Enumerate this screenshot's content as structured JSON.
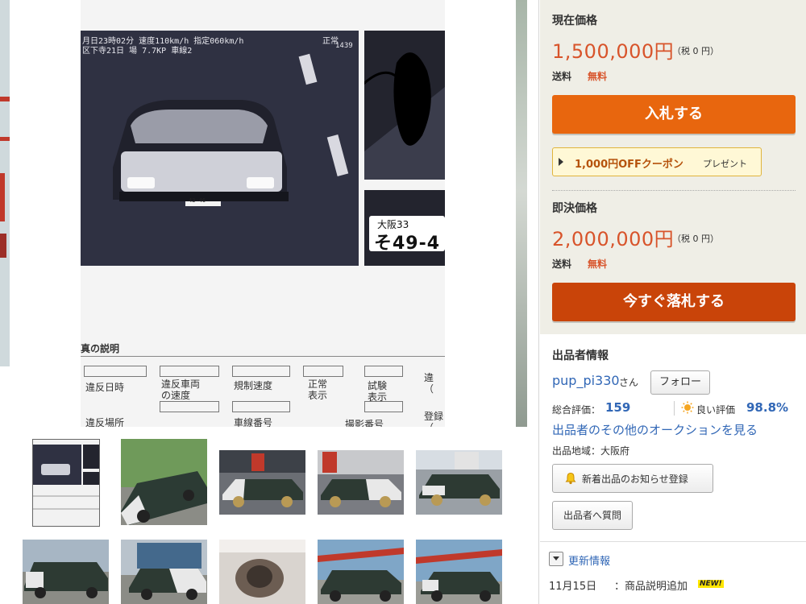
{
  "colors": {
    "accent_orange": "#e8660e",
    "buynow_orange": "#c94409",
    "price_text": "#d8542b",
    "link_blue": "#3167b6",
    "panel_bg": "#efeee6",
    "coupon_bg": "#fff8d6"
  },
  "photo": {
    "overlay_line1": "月日23時02分  速度110km/h  指定060km/h",
    "overlay_line2": "区下寺21日  場  7.7KP  車線2",
    "overlay_status": "正常",
    "overlay_code": "1439",
    "plate_small": "43-46",
    "plate_region": "大阪33",
    "plate_number": "そ49-4",
    "form_title": "真の説明",
    "form_fields": [
      "違反日時",
      "違反車両\nの速度",
      "規制速度",
      "正常\n表示",
      "試験\n表示",
      "違\n（"
    ],
    "form_row2": [
      "違反場所",
      "車線番号",
      "撮影番号",
      "登録\n（"
    ]
  },
  "thumbnails": [
    {
      "name": "thumb-1",
      "selected": true
    },
    {
      "name": "thumb-2",
      "selected": false
    },
    {
      "name": "thumb-3",
      "selected": false
    },
    {
      "name": "thumb-4",
      "selected": false
    },
    {
      "name": "thumb-5",
      "selected": false
    },
    {
      "name": "thumb-6",
      "selected": false
    },
    {
      "name": "thumb-7",
      "selected": false
    },
    {
      "name": "thumb-8",
      "selected": false
    },
    {
      "name": "thumb-9",
      "selected": false
    },
    {
      "name": "thumb-10",
      "selected": false
    }
  ],
  "current_price": {
    "label": "現在価格",
    "value": "1,500,000円",
    "tax": "（税 0 円）",
    "shipping_label": "送料",
    "shipping_value": "無料",
    "bid_button": "入札する"
  },
  "coupon": {
    "main": "1,000円OFFクーポン",
    "sub": "プレゼント"
  },
  "buynow_price": {
    "label": "即決価格",
    "value": "2,000,000円",
    "tax": "（税 0 円）",
    "shipping_label": "送料",
    "shipping_value": "無料",
    "buy_button": "今すぐ落札する"
  },
  "seller": {
    "title": "出品者情報",
    "name": "pup_pi330",
    "honorific": "さん",
    "follow_button": "フォロー",
    "rating_label": "総合評価：",
    "rating_value": "159",
    "good_label": "良い評価",
    "good_value": "98.8%",
    "other_auctions_link": "出品者のその他のオークションを見る",
    "location": "出品地域：大阪府",
    "notify_button": "新着出品のお知らせ登録",
    "question_button": "出品者へ質問"
  },
  "updates": {
    "title": "更新情報",
    "date": "11月15日",
    "text": "：商品説明追加",
    "badge": "NEW!"
  }
}
